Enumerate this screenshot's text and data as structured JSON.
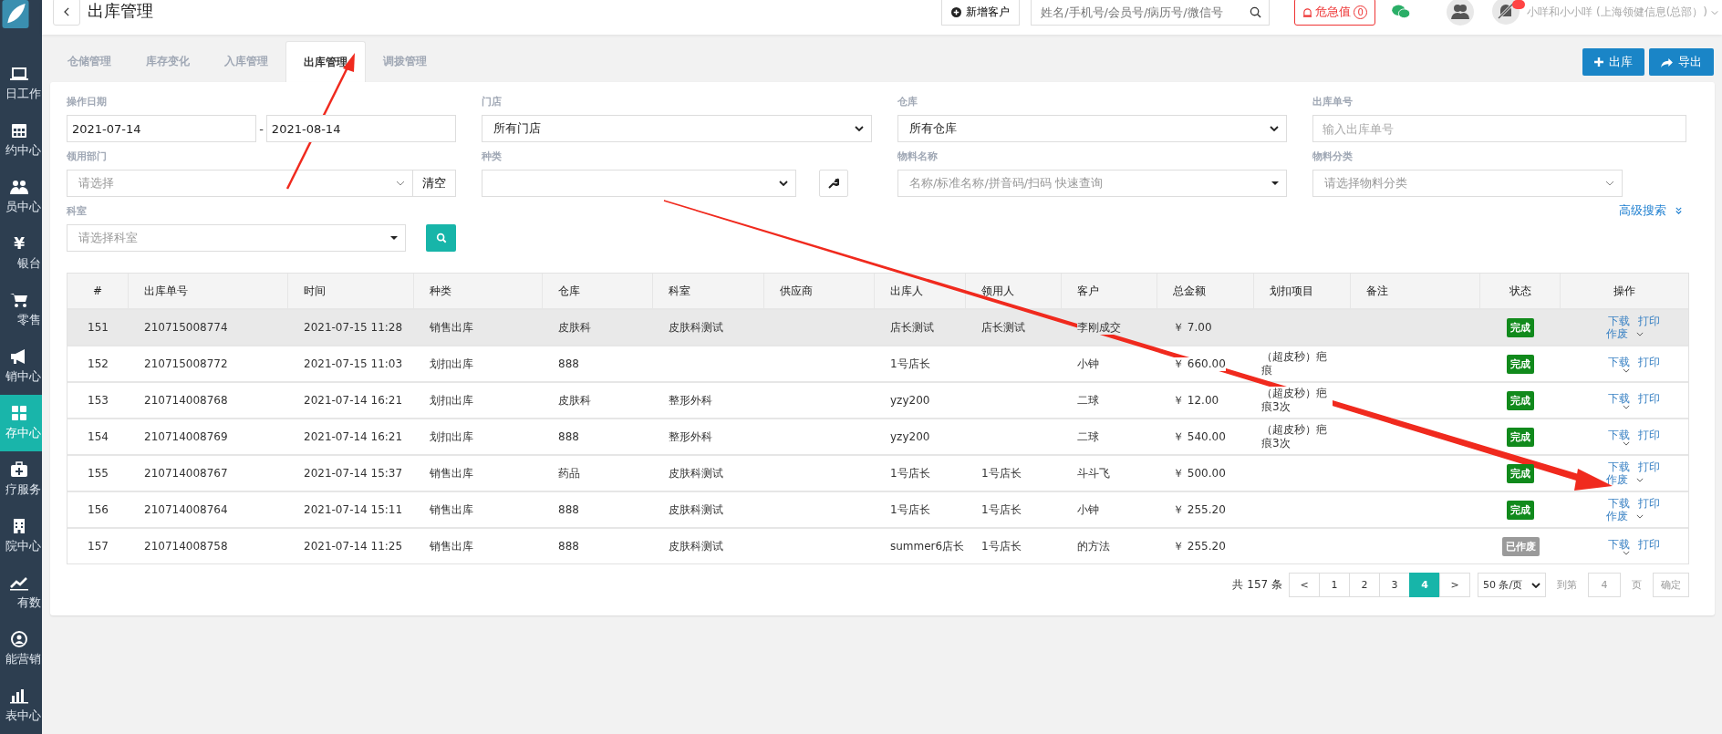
{
  "sidebar": {
    "items": [
      {
        "label": "日工作",
        "selected": false
      },
      {
        "label": "约中心",
        "selected": false
      },
      {
        "label": "员中心",
        "selected": false
      },
      {
        "label": "银台",
        "glyph": "¥",
        "selected": false
      },
      {
        "label": "零售",
        "selected": false
      },
      {
        "label": "销中心",
        "selected": false
      },
      {
        "label": "存中心",
        "selected": true
      },
      {
        "label": "疗服务",
        "selected": false
      },
      {
        "label": "院中心",
        "selected": false
      },
      {
        "label": "有数",
        "selected": false
      },
      {
        "label": "能营销",
        "selected": false
      },
      {
        "label": "表中心",
        "selected": false
      }
    ]
  },
  "header": {
    "title": "出库管理",
    "new_customer": "新增客户",
    "search": {
      "placeholder": "姓名/手机号/会员号/病历号/微信号"
    },
    "alert": {
      "label": "危急值",
      "count": "0"
    },
    "user": "小咩和小小咩 (上海领健信息(总部）)"
  },
  "tabs": [
    {
      "label": "仓储管理",
      "selected": false
    },
    {
      "label": "库存变化",
      "selected": false
    },
    {
      "label": "入库管理",
      "selected": false
    },
    {
      "label": "出库管理",
      "selected": true
    },
    {
      "label": "调拨管理",
      "selected": false
    }
  ],
  "actions": [
    "出库",
    "导出"
  ],
  "filters": {
    "date": {
      "label": "操作日期",
      "from": "2021-07-14",
      "sep": "-",
      "to": "2021-08-14"
    },
    "store": {
      "label": "门店",
      "value": "所有门店"
    },
    "warehouse": {
      "label": "仓库",
      "value": "所有仓库"
    },
    "order_no": {
      "label": "出库单号",
      "placeholder": "输入出库单号"
    },
    "department": {
      "label": "领用部门",
      "placeholder": "请选择",
      "clear": "清空"
    },
    "category": {
      "label": "种类"
    },
    "material": {
      "label": "物料名称",
      "placeholder": "名称/标准名称/拼音码/扫码 快速查询"
    },
    "material_class": {
      "label": "物料分类",
      "placeholder": "请选择物料分类"
    },
    "room": {
      "label": "科室",
      "placeholder": "请选择科室"
    },
    "advanced": "高级搜索"
  },
  "table": {
    "columns": [
      "#",
      "出库单号",
      "时间",
      "种类",
      "仓库",
      "科室",
      "供应商",
      "出库人",
      "领用人",
      "客户",
      "总金额",
      "划扣项目",
      "备注",
      "状态",
      "操作"
    ],
    "rows": [
      {
        "selected": true,
        "cells": [
          "151",
          "210715008774",
          "2021-07-15 11:28",
          "销售出库",
          "皮肤科",
          "皮肤科测试",
          "",
          "店长测试",
          "店长测试",
          "李刚成交",
          "￥ 7.00",
          "",
          ""
        ],
        "status": {
          "text": "完成",
          "kind": "done"
        },
        "ops": [
          "下载",
          "打印",
          "作废"
        ]
      },
      {
        "selected": false,
        "cells": [
          "152",
          "210715008772",
          "2021-07-15 11:03",
          "划扣出库",
          "888",
          "",
          "",
          "1号店长",
          "",
          "小钟",
          "￥ 660.00",
          "（超皮秒）疤痕",
          ""
        ],
        "status": {
          "text": "完成",
          "kind": "done"
        },
        "ops": [
          "下载",
          "打印"
        ]
      },
      {
        "selected": false,
        "cells": [
          "153",
          "210714008768",
          "2021-07-14 16:21",
          "划扣出库",
          "皮肤科",
          "整形外科",
          "",
          "yzy200",
          "",
          "二球",
          "￥ 12.00",
          "（超皮秒）疤痕3次",
          ""
        ],
        "status": {
          "text": "完成",
          "kind": "done"
        },
        "ops": [
          "下载",
          "打印"
        ]
      },
      {
        "selected": false,
        "cells": [
          "154",
          "210714008769",
          "2021-07-14 16:21",
          "划扣出库",
          "888",
          "整形外科",
          "",
          "yzy200",
          "",
          "二球",
          "￥ 540.00",
          "（超皮秒）疤痕3次",
          ""
        ],
        "status": {
          "text": "完成",
          "kind": "done"
        },
        "ops": [
          "下载",
          "打印"
        ]
      },
      {
        "selected": false,
        "cells": [
          "155",
          "210714008767",
          "2021-07-14 15:37",
          "销售出库",
          "药品",
          "皮肤科测试",
          "",
          "1号店长",
          "1号店长",
          "斗斗飞",
          "￥ 500.00",
          "",
          ""
        ],
        "status": {
          "text": "完成",
          "kind": "done"
        },
        "ops": [
          "下载",
          "打印",
          "作废"
        ]
      },
      {
        "selected": false,
        "cells": [
          "156",
          "210714008764",
          "2021-07-14 15:11",
          "销售出库",
          "888",
          "皮肤科测试",
          "",
          "1号店长",
          "1号店长",
          "小钟",
          "￥ 255.20",
          "",
          ""
        ],
        "status": {
          "text": "完成",
          "kind": "done"
        },
        "ops": [
          "下载",
          "打印",
          "作废"
        ]
      },
      {
        "selected": false,
        "cells": [
          "157",
          "210714008758",
          "2021-07-14 11:25",
          "销售出库",
          "888",
          "皮肤科测试",
          "",
          "summer6店长",
          "1号店长",
          "的方法",
          "￥ 255.20",
          "",
          ""
        ],
        "status": {
          "text": "已作废",
          "kind": "void"
        },
        "ops": [
          "下载",
          "打印"
        ]
      }
    ]
  },
  "pagination": {
    "total": "共 157 条",
    "prev": "<",
    "pages": [
      {
        "label": "1",
        "selected": false
      },
      {
        "label": "2",
        "selected": false
      },
      {
        "label": "3",
        "selected": false
      },
      {
        "label": "4",
        "selected": true
      }
    ],
    "next": ">",
    "page_size": "50 条/页",
    "goto_label": "到第",
    "goto_value": "4",
    "goto_unit": "页",
    "confirm": "确定"
  }
}
